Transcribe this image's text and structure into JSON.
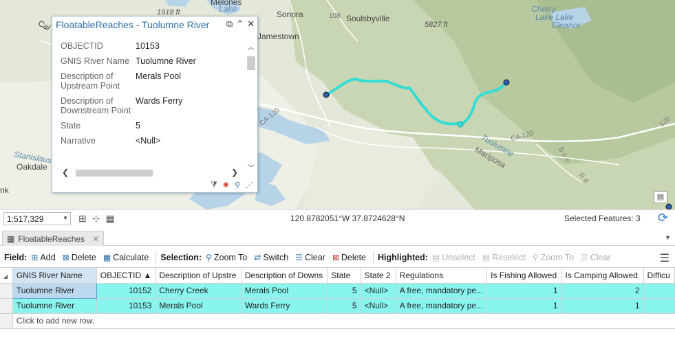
{
  "map": {
    "labels": {
      "melones": "Melones",
      "lake": "Lake",
      "elev1918": "1918 ft",
      "sonora": "Sonora",
      "soulsbyville": "Soulsbyville",
      "hwy108": "108",
      "jamestown": "Jamestown",
      "elev5827": "5827 ft",
      "cherry": "Cherry",
      "cherryLake": "Lake Lake",
      "eleanor": "Eleanor",
      "ca120a": "CA-120",
      "ca120b": "CA-120",
      "ca120c": "120",
      "tuolumne": "Tuolumne",
      "mariposa": "Mariposa",
      "b0": "B o e",
      "rd": "R d",
      "stanislaus": "Stanislaus",
      "oakdale": "Oakdale",
      "nk": "nk",
      "calaveras": "Cal"
    },
    "river_color": "#33dcd4"
  },
  "popup": {
    "title": "FloatableReaches - Tuolumne River",
    "fields": [
      {
        "key": "OBJECTID",
        "value": "10153"
      },
      {
        "key": "GNIS River Name",
        "value": "Tuolumne River"
      },
      {
        "key": "Description of Upstream Point",
        "value": "Merals Pool"
      },
      {
        "key": "Description of Downstream Point",
        "value": "Wards Ferry"
      },
      {
        "key": "State",
        "value": "5"
      },
      {
        "key": "Narrative",
        "value": "<Null>"
      }
    ]
  },
  "status": {
    "scale": "1:517,329",
    "coordinates": "120.8782051°W 37.8724628°N",
    "selected_features": "Selected Features: 3"
  },
  "table_tab": {
    "label": "FloatableReaches"
  },
  "toolbar": {
    "field_label": "Field:",
    "add": "Add",
    "delete": "Delete",
    "calculate": "Calculate",
    "selection_label": "Selection:",
    "zoom_to": "Zoom To",
    "switch": "Switch",
    "clear": "Clear",
    "delete2": "Delete",
    "highlighted_label": "Highlighted:",
    "unselect": "Unselect",
    "reselect": "Reselect",
    "zoom_to2": "Zoom To",
    "clear2": "Clear"
  },
  "table": {
    "columns": [
      "GNIS River Name",
      "OBJECTID ▲",
      "Description of Upstre",
      "Description of Downs",
      "State",
      "State 2",
      "Regulations",
      "Is Fishing Allowed",
      "Is Camping Allowed",
      "Difficu"
    ],
    "rows": [
      [
        "Tuolumne River",
        "10152",
        "Cherry Creek",
        "Merals Pool",
        "5",
        "<Null>",
        "A free, mandatory pe...",
        "1",
        "2",
        ""
      ],
      [
        "Tuolumne River",
        "10153",
        "Merals Pool",
        "Wards Ferry",
        "5",
        "<Null>",
        "A free, mandatory pe...",
        "1",
        "1",
        ""
      ]
    ],
    "add_row_text": "Click to add new row."
  }
}
